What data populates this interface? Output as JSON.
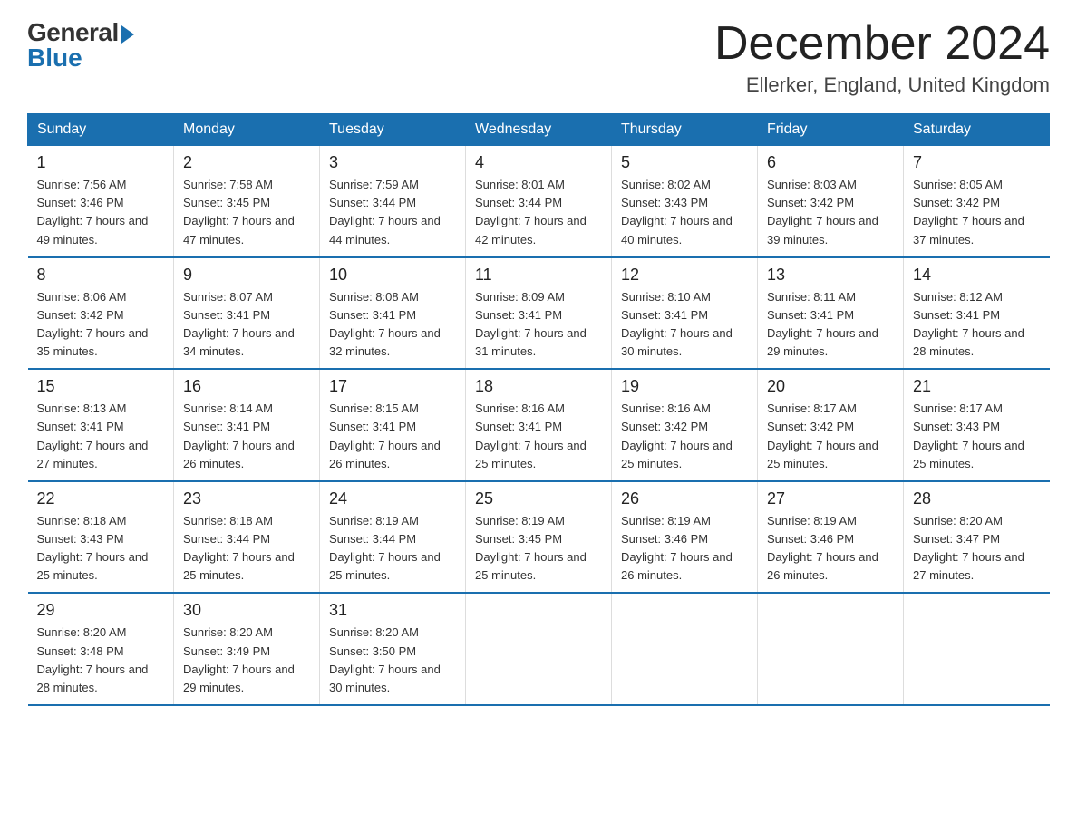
{
  "header": {
    "logo_general": "General",
    "logo_blue": "Blue",
    "month_title": "December 2024",
    "location": "Ellerker, England, United Kingdom"
  },
  "days_of_week": [
    "Sunday",
    "Monday",
    "Tuesday",
    "Wednesday",
    "Thursday",
    "Friday",
    "Saturday"
  ],
  "weeks": [
    [
      {
        "day": "1",
        "sunrise": "7:56 AM",
        "sunset": "3:46 PM",
        "daylight": "7 hours and 49 minutes."
      },
      {
        "day": "2",
        "sunrise": "7:58 AM",
        "sunset": "3:45 PM",
        "daylight": "7 hours and 47 minutes."
      },
      {
        "day": "3",
        "sunrise": "7:59 AM",
        "sunset": "3:44 PM",
        "daylight": "7 hours and 44 minutes."
      },
      {
        "day": "4",
        "sunrise": "8:01 AM",
        "sunset": "3:44 PM",
        "daylight": "7 hours and 42 minutes."
      },
      {
        "day": "5",
        "sunrise": "8:02 AM",
        "sunset": "3:43 PM",
        "daylight": "7 hours and 40 minutes."
      },
      {
        "day": "6",
        "sunrise": "8:03 AM",
        "sunset": "3:42 PM",
        "daylight": "7 hours and 39 minutes."
      },
      {
        "day": "7",
        "sunrise": "8:05 AM",
        "sunset": "3:42 PM",
        "daylight": "7 hours and 37 minutes."
      }
    ],
    [
      {
        "day": "8",
        "sunrise": "8:06 AM",
        "sunset": "3:42 PM",
        "daylight": "7 hours and 35 minutes."
      },
      {
        "day": "9",
        "sunrise": "8:07 AM",
        "sunset": "3:41 PM",
        "daylight": "7 hours and 34 minutes."
      },
      {
        "day": "10",
        "sunrise": "8:08 AM",
        "sunset": "3:41 PM",
        "daylight": "7 hours and 32 minutes."
      },
      {
        "day": "11",
        "sunrise": "8:09 AM",
        "sunset": "3:41 PM",
        "daylight": "7 hours and 31 minutes."
      },
      {
        "day": "12",
        "sunrise": "8:10 AM",
        "sunset": "3:41 PM",
        "daylight": "7 hours and 30 minutes."
      },
      {
        "day": "13",
        "sunrise": "8:11 AM",
        "sunset": "3:41 PM",
        "daylight": "7 hours and 29 minutes."
      },
      {
        "day": "14",
        "sunrise": "8:12 AM",
        "sunset": "3:41 PM",
        "daylight": "7 hours and 28 minutes."
      }
    ],
    [
      {
        "day": "15",
        "sunrise": "8:13 AM",
        "sunset": "3:41 PM",
        "daylight": "7 hours and 27 minutes."
      },
      {
        "day": "16",
        "sunrise": "8:14 AM",
        "sunset": "3:41 PM",
        "daylight": "7 hours and 26 minutes."
      },
      {
        "day": "17",
        "sunrise": "8:15 AM",
        "sunset": "3:41 PM",
        "daylight": "7 hours and 26 minutes."
      },
      {
        "day": "18",
        "sunrise": "8:16 AM",
        "sunset": "3:41 PM",
        "daylight": "7 hours and 25 minutes."
      },
      {
        "day": "19",
        "sunrise": "8:16 AM",
        "sunset": "3:42 PM",
        "daylight": "7 hours and 25 minutes."
      },
      {
        "day": "20",
        "sunrise": "8:17 AM",
        "sunset": "3:42 PM",
        "daylight": "7 hours and 25 minutes."
      },
      {
        "day": "21",
        "sunrise": "8:17 AM",
        "sunset": "3:43 PM",
        "daylight": "7 hours and 25 minutes."
      }
    ],
    [
      {
        "day": "22",
        "sunrise": "8:18 AM",
        "sunset": "3:43 PM",
        "daylight": "7 hours and 25 minutes."
      },
      {
        "day": "23",
        "sunrise": "8:18 AM",
        "sunset": "3:44 PM",
        "daylight": "7 hours and 25 minutes."
      },
      {
        "day": "24",
        "sunrise": "8:19 AM",
        "sunset": "3:44 PM",
        "daylight": "7 hours and 25 minutes."
      },
      {
        "day": "25",
        "sunrise": "8:19 AM",
        "sunset": "3:45 PM",
        "daylight": "7 hours and 25 minutes."
      },
      {
        "day": "26",
        "sunrise": "8:19 AM",
        "sunset": "3:46 PM",
        "daylight": "7 hours and 26 minutes."
      },
      {
        "day": "27",
        "sunrise": "8:19 AM",
        "sunset": "3:46 PM",
        "daylight": "7 hours and 26 minutes."
      },
      {
        "day": "28",
        "sunrise": "8:20 AM",
        "sunset": "3:47 PM",
        "daylight": "7 hours and 27 minutes."
      }
    ],
    [
      {
        "day": "29",
        "sunrise": "8:20 AM",
        "sunset": "3:48 PM",
        "daylight": "7 hours and 28 minutes."
      },
      {
        "day": "30",
        "sunrise": "8:20 AM",
        "sunset": "3:49 PM",
        "daylight": "7 hours and 29 minutes."
      },
      {
        "day": "31",
        "sunrise": "8:20 AM",
        "sunset": "3:50 PM",
        "daylight": "7 hours and 30 minutes."
      },
      null,
      null,
      null,
      null
    ]
  ]
}
